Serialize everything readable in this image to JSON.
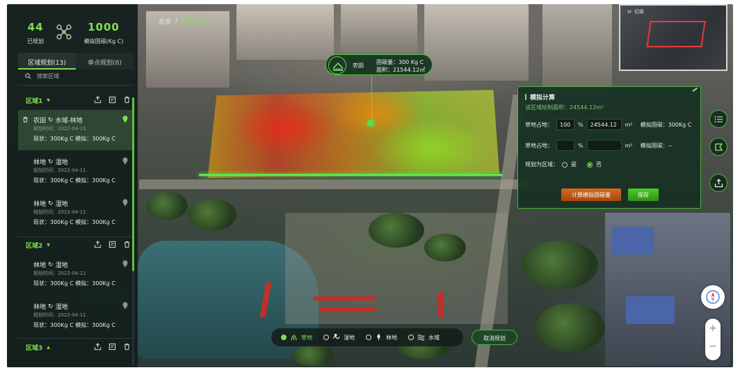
{
  "stats": {
    "planned_count": "44",
    "planned_label": "已规划",
    "carbon_value": "1000",
    "carbon_label": "模拟固碳(Kg C)"
  },
  "tabs": [
    {
      "label": "区域规划(13)",
      "active": true
    },
    {
      "label": "单点规划(8)",
      "active": false
    }
  ],
  "search": {
    "placeholder": "搜索区域"
  },
  "regions": [
    {
      "label": "区域1"
    },
    {
      "label": "区域2"
    },
    {
      "label": "区域3"
    }
  ],
  "items": [
    {
      "title_a": "农田",
      "title_b": "水域-林地",
      "date": "规划时间：2022-04-11",
      "values": "现状：300Kg C    模拟：300Kg C"
    },
    {
      "title_a": "林地",
      "title_b": "湿地",
      "date": "规划时间：2022-04-11",
      "values": "现状：300Kg C    模拟：300Kg C"
    },
    {
      "title_a": "林地",
      "title_b": "湿地",
      "date": "规划时间：2022-04-11",
      "values": "现状：300Kg C    模拟：300Kg C"
    },
    {
      "title_a": "林地",
      "title_b": "湿地",
      "date": "规划时间：2022-04-11",
      "values": "现状：300Kg C    模拟：300Kg C"
    },
    {
      "title_a": "林地",
      "title_b": "湿地",
      "date": "规划时间：2022-04-11",
      "values": "现状：300Kg C    模拟：300Kg C"
    }
  ],
  "breadcrumb": {
    "root": "总览",
    "separator": "/",
    "current": "行政A区"
  },
  "callout": {
    "name": "农田",
    "carbon": "固碳量：300 Kg C",
    "area": "面积：21544.12㎡"
  },
  "minimap": {
    "switch_label": "切换"
  },
  "calc": {
    "title": "模拟计算",
    "area_text": "该区域绘制面积：24544.12m²",
    "grass_label": "草地占地：",
    "grass_percent": "100",
    "percent_sign": "%",
    "grass_area": "24544.12",
    "area_unit": "m²",
    "grass_sim": "模拟固碳：300Kg C",
    "grass2_label": "草地占地：",
    "grass2_percent": "",
    "grass2_area": "",
    "grass2_sim": "模拟固碳：--",
    "plan_label": "规划为区域：",
    "yes": "是",
    "no": "否",
    "calc_button": "计算模拟固碳量",
    "save_button": "保存"
  },
  "legend": [
    {
      "label": "草地",
      "checked": true
    },
    {
      "label": "湿地",
      "checked": false
    },
    {
      "label": "林地",
      "checked": false
    },
    {
      "label": "水域",
      "checked": false
    }
  ],
  "cancel_button": "取消规划",
  "zoom": {
    "plus": "+",
    "minus": "−"
  },
  "colors": {
    "accent": "#7ee04b",
    "calc_button": "#d46a1e",
    "save_button": "#4ecb2a",
    "minimap_selection": "#e53c3c"
  }
}
